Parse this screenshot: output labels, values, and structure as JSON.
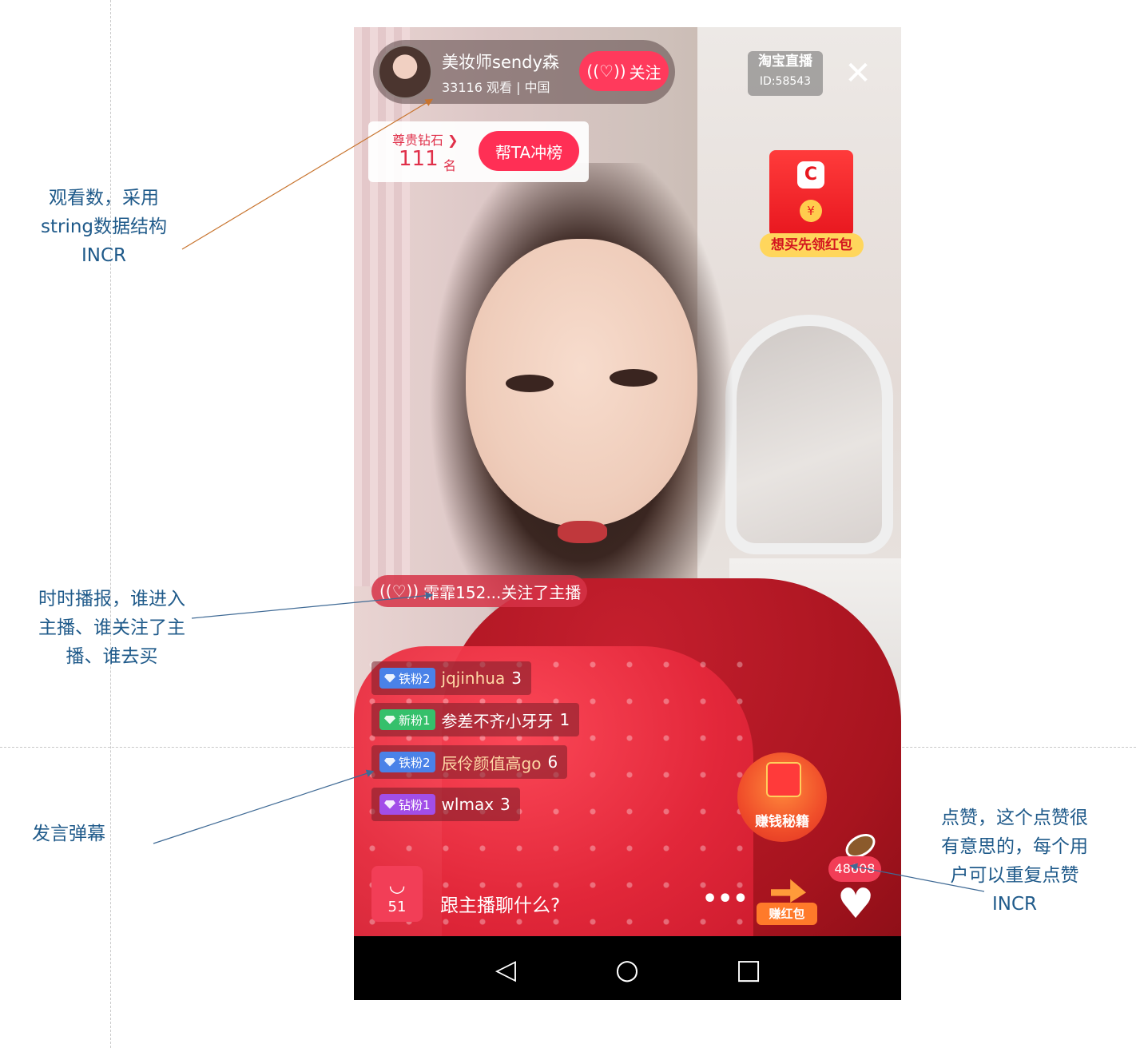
{
  "annotations": {
    "views_note": [
      "观看数，采用",
      "string数据结构",
      "INCR"
    ],
    "enter_note": [
      "时时播报，谁进入",
      "主播、谁关注了主",
      "播、谁去买"
    ],
    "danmu_note": [
      "发言弹幕"
    ],
    "likes_note": [
      "点赞，这个点赞很",
      "有意思的，每个用",
      "户可以重复点赞",
      "INCR"
    ]
  },
  "host": {
    "name": "美妆师sendy森",
    "meta": "33116 观看 |  中国",
    "follow_label": "关注"
  },
  "platform": {
    "title": "淘宝直播",
    "id": "ID:58543"
  },
  "close_icon": "✕",
  "rank": {
    "label": "尊贵钻石 ❯",
    "number": "111",
    "unit": "名",
    "button": "帮TA冲榜"
  },
  "redpack": {
    "logo": "C",
    "coin": "¥",
    "label": "想买先领红包"
  },
  "enter_message": {
    "text": "霏霏152...关注了主播"
  },
  "chat": [
    {
      "badge": "铁粉2",
      "user": "jqjinhua",
      "count": "3"
    },
    {
      "badge": "新粉1",
      "user": "参差不齐小牙牙",
      "count": "1"
    },
    {
      "badge": "铁粉2",
      "user": "辰伶颜值高go",
      "count": "6"
    },
    {
      "badge": "钻粉1",
      "user": "wlmax",
      "count": "3"
    }
  ],
  "earn_secret_label": "赚钱秘籍",
  "shop": {
    "icon": "◡",
    "count": "51"
  },
  "chat_input_placeholder": "跟主播聊什么?",
  "more_label": "•••",
  "earn_redpack_label": "赚红包",
  "likes": {
    "count": "48608",
    "heart_icon": "♥"
  },
  "navbar": {
    "back_icon": "◁",
    "home_icon": "○",
    "recent_icon": "□"
  },
  "colors": {
    "annotation_text": "#1f5a8a",
    "accent_red": "#ff2f55",
    "arrow_orange": "#c8742e",
    "arrow_blue": "#3f6a95"
  }
}
